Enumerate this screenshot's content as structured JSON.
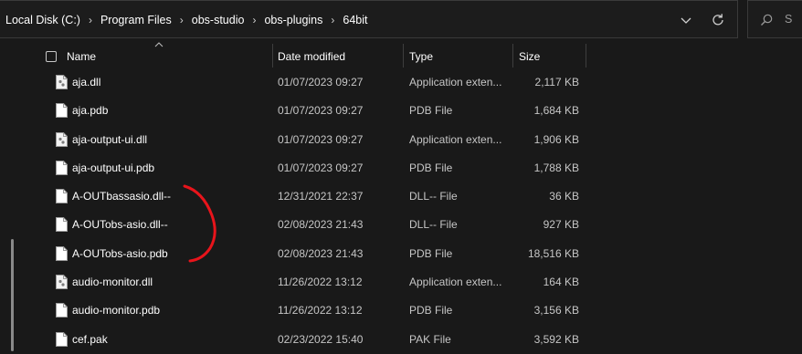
{
  "address": {
    "crumbs": [
      "Local Disk (C:)",
      "Program Files",
      "obs-studio",
      "obs-plugins",
      "64bit"
    ],
    "separator": "›"
  },
  "search": {
    "placeholder": "S"
  },
  "columns": {
    "name": "Name",
    "date": "Date modified",
    "type": "Type",
    "size": "Size"
  },
  "files": [
    {
      "name": "aja.dll",
      "date": "01/07/2023 09:27",
      "type": "Application exten...",
      "size": "2,117 KB",
      "icon": "dll-file-icon"
    },
    {
      "name": "aja.pdb",
      "date": "01/07/2023 09:27",
      "type": "PDB File",
      "size": "1,684 KB",
      "icon": "file-icon"
    },
    {
      "name": "aja-output-ui.dll",
      "date": "01/07/2023 09:27",
      "type": "Application exten...",
      "size": "1,906 KB",
      "icon": "dll-file-icon"
    },
    {
      "name": "aja-output-ui.pdb",
      "date": "01/07/2023 09:27",
      "type": "PDB File",
      "size": "1,788 KB",
      "icon": "file-icon"
    },
    {
      "name": "A-OUTbassasio.dll--",
      "date": "12/31/2021 22:37",
      "type": "DLL-- File",
      "size": "36 KB",
      "icon": "file-icon"
    },
    {
      "name": "A-OUTobs-asio.dll--",
      "date": "02/08/2023 21:43",
      "type": "DLL-- File",
      "size": "927 KB",
      "icon": "file-icon"
    },
    {
      "name": "A-OUTobs-asio.pdb",
      "date": "02/08/2023 21:43",
      "type": "PDB File",
      "size": "18,516 KB",
      "icon": "file-icon"
    },
    {
      "name": "audio-monitor.dll",
      "date": "11/26/2022 13:12",
      "type": "Application exten...",
      "size": "164 KB",
      "icon": "dll-file-icon"
    },
    {
      "name": "audio-monitor.pdb",
      "date": "11/26/2022 13:12",
      "type": "PDB File",
      "size": "3,156 KB",
      "icon": "file-icon"
    },
    {
      "name": "cef.pak",
      "date": "02/23/2022 15:40",
      "type": "PAK File",
      "size": "3,592 KB",
      "icon": "file-icon"
    }
  ],
  "colors": {
    "background": "#191919",
    "annotation": "#e8141b",
    "text": "#ffffff",
    "secondary_text": "#c6c6c6"
  }
}
